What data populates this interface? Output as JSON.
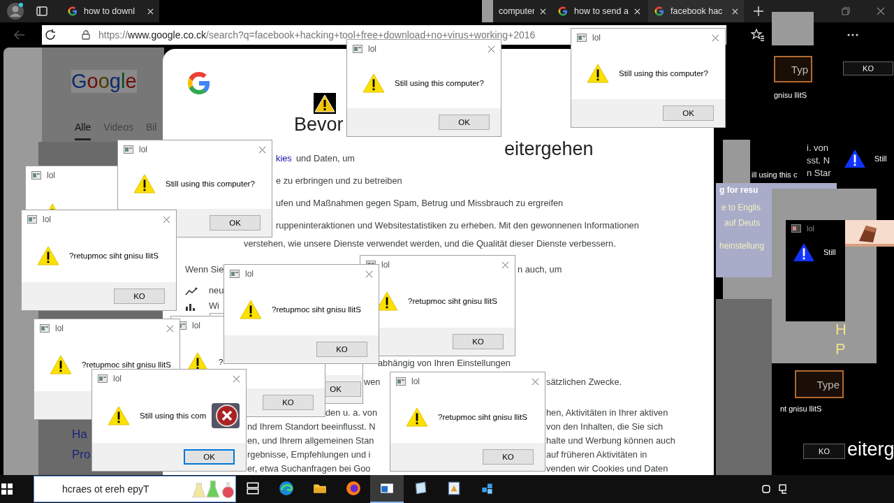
{
  "browser": {
    "tabs": [
      {
        "title": "how to downl",
        "selected": false,
        "kind": "google"
      },
      {
        "title": "computer",
        "selected": false,
        "kind": "plain"
      },
      {
        "title": "how to send a",
        "selected": false,
        "kind": "google"
      },
      {
        "title": "facebook hac",
        "selected": true,
        "kind": "google"
      }
    ],
    "address": {
      "scheme": "https://",
      "host": "www.google.co.ck",
      "path": "/search?q=facebook+hacking+tool+free+download+no+virus+working+2016"
    }
  },
  "results_page": {
    "logo": "Google",
    "nav": [
      {
        "label": "Alle",
        "selected": true
      },
      {
        "label": "Videos",
        "selected": false
      },
      {
        "label": "Bil",
        "selected": false
      }
    ],
    "result_fragments": [
      "Ha",
      "Pro"
    ]
  },
  "consent": {
    "heading_left": "Bevor",
    "heading_right": "eitergehen",
    "fragments": [
      {
        "text": "kies",
        "kind": "link"
      },
      {
        "text": "und Daten, um",
        "kind": "text"
      },
      {
        "text": "e zu erbringen und zu betreiben",
        "kind": "text"
      },
      {
        "text": "ufen und Maßnahmen gegen Spam, Betrug und Missbrauch zu ergreifen",
        "kind": "text"
      },
      {
        "text": "ruppeninteraktionen und Websitestatistiken zu erheben. Mit den gewonnenen Informationen",
        "kind": "text"
      },
      {
        "text": "verstehen, wie unsere Dienste verwendet werden, und die Qualität dieser Dienste verbessern.",
        "kind": "text"
      },
      {
        "text": "Wenn Sie",
        "kind": "text"
      },
      {
        "text": "n auch, um",
        "kind": "text"
      },
      {
        "text": "neu",
        "kind": "trend"
      },
      {
        "text": "Wi",
        "kind": "bars"
      },
      {
        "text": "abhängig von Ihren Einstellungen",
        "kind": "text"
      },
      {
        "text": "wen",
        "kind": "text"
      },
      {
        "text": "sätzlichen Zwecke.",
        "kind": "text"
      },
      {
        "text": "den u. a. von",
        "kind": "text"
      },
      {
        "text": "hen, Aktivitäten in Ihrer aktiven",
        "kind": "text"
      },
      {
        "text": "nd Ihrem Standort beeinflusst. N",
        "kind": "text"
      },
      {
        "text": "von den Inhalten, die Sie sich",
        "kind": "text"
      },
      {
        "text": "en, und Ihrem allgemeinen Stan",
        "kind": "text"
      },
      {
        "text": "halte und Werbung können auch",
        "kind": "text"
      },
      {
        "text": "rgebnisse, Empfehlungen und i",
        "kind": "text"
      },
      {
        "text": "auf früheren Aktivitäten in",
        "kind": "text"
      },
      {
        "text": "er, etwa Suchanfragen bei Goo",
        "kind": "text"
      },
      {
        "text": "venden wir Cookies und Daten",
        "kind": "text"
      }
    ]
  },
  "dialogs": [
    {
      "title": "lol",
      "message": "Still using this computer?",
      "button": "OK",
      "focused": false,
      "error_badge": false
    },
    {
      "title": "lol",
      "message": "Still using this computer?",
      "button": "OK",
      "focused": false,
      "error_badge": false
    },
    {
      "title": "lol",
      "error_badge": false
    },
    {
      "title": "lol",
      "message": "Still using this computer?",
      "button": "OK",
      "focused": false,
      "error_badge": false
    },
    {
      "title": "lol",
      "message": "?retupmoc siht gnisu llitS",
      "button": "KO",
      "focused": false,
      "error_badge": false
    },
    {
      "title": "lol",
      "message": "?retupmoc siht gnisu llitS",
      "button": "KO",
      "focused": false,
      "error_badge": false
    },
    {
      "button": "OK",
      "focused": false,
      "error_badge": false
    },
    {
      "title": "lol",
      "message": "?",
      "button": "KO",
      "focused": false,
      "error_badge": false
    },
    {
      "title": "lol",
      "message": "?retupmoc siht gnisu llitS",
      "button": "KO",
      "focused": false,
      "error_badge": false
    },
    {
      "title": "lol",
      "message": "?retupmoc siht gnisu llitS",
      "error_badge": false
    },
    {
      "title": "lol",
      "message": "Still using this com",
      "button": "OK",
      "focused": true,
      "error_badge": true
    },
    {
      "title": "lol",
      "message": "?retupmoc siht gnisu llitS",
      "button": "KO",
      "focused": false,
      "error_badge": false
    }
  ],
  "dark_windows": [
    {
      "title": "lol",
      "message": "Still"
    },
    {
      "message": "Still"
    }
  ],
  "dark_fields": [
    "Typ",
    "Type"
  ],
  "dark_buttons": [
    "KO",
    "KO"
  ],
  "glitch_texts": [
    {
      "text": "gnisu llitS",
      "kind": "small"
    },
    {
      "text": "i. von",
      "kind": "plain"
    },
    {
      "text": "sst. N",
      "kind": "plain"
    },
    {
      "text": "ill using this c",
      "kind": "small"
    },
    {
      "text": "n Star",
      "kind": "plain"
    },
    {
      "text": "g for resu",
      "kind": "bold"
    },
    {
      "text": "e to Englis",
      "kind": "pale"
    },
    {
      "text": "auf Deuts",
      "kind": "pale"
    },
    {
      "text": "heinstellung",
      "kind": "pale"
    },
    {
      "text": "H",
      "kind": "yellow"
    },
    {
      "text": "P",
      "kind": "yellow"
    },
    {
      "text": "nt gnisu llitS",
      "kind": "small"
    },
    {
      "text": "eiterg",
      "kind": "big"
    }
  ],
  "taskbar": {
    "search_placeholder": "hcraes ot ereh epyT",
    "apps": [
      {
        "kind": "taskview",
        "selected": false
      },
      {
        "kind": "edge",
        "selected": false
      },
      {
        "kind": "explorer",
        "selected": false
      },
      {
        "kind": "firefox",
        "selected": false
      },
      {
        "kind": "window",
        "selected": true
      },
      {
        "kind": "notepad",
        "selected": false
      },
      {
        "kind": "paint",
        "selected": false
      },
      {
        "kind": "app",
        "selected": false
      }
    ]
  }
}
